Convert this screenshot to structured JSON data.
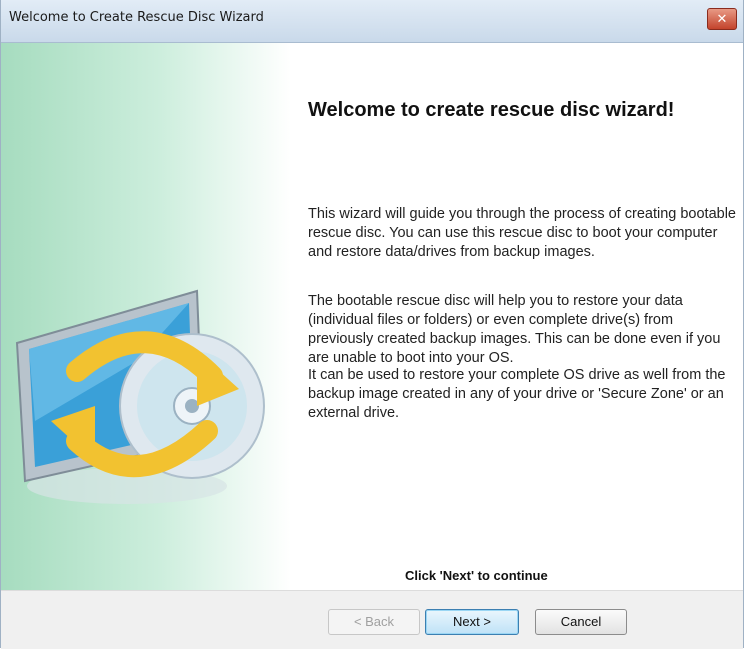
{
  "window": {
    "title": "Welcome to Create Rescue Disc Wizard",
    "close_symbol": "✕"
  },
  "main": {
    "heading": "Welcome to create rescue disc wizard!",
    "paragraphs": [
      "This wizard will guide you through the process of creating bootable rescue disc. You can use this rescue disc to boot your computer and restore data/drives from backup images.",
      "The bootable rescue disc will help you to restore your data (individual files or folders) or even complete drive(s) from previously created backup images. This can be done even if you are unable to boot into your OS.",
      "It can be used to restore your complete OS drive as well from the backup image created in any of your drive or 'Secure Zone' or an external drive."
    ],
    "instruction": "Click 'Next' to continue"
  },
  "buttons": {
    "back": "< Back",
    "next": "Next >",
    "cancel": "Cancel"
  },
  "illustration": {
    "icon": "monitor-disc-sync-icon",
    "colors": {
      "panel_green": "#a6dcbf",
      "arrow_yellow": "#f2c230",
      "screen_blue": "#3aa0d8"
    }
  }
}
